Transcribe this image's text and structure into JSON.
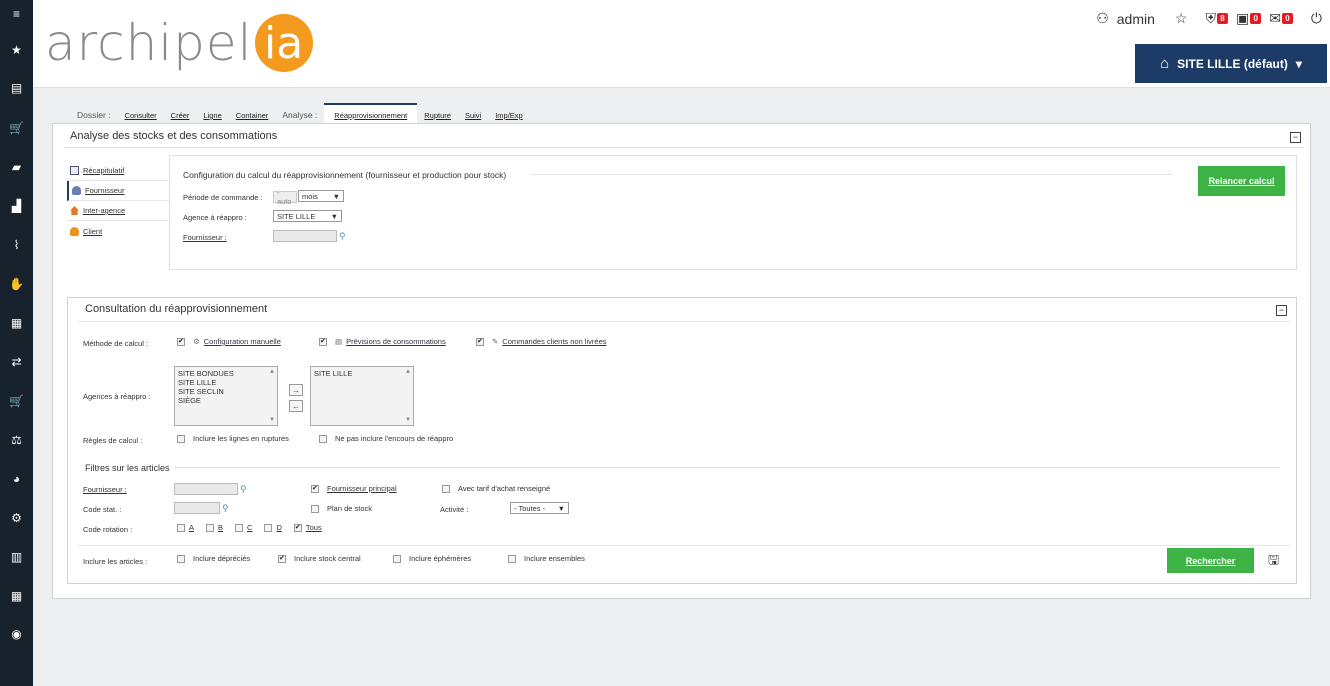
{
  "header": {
    "logo_text": "archipel",
    "logo_badge": "ia",
    "user": "admin",
    "badges": [
      "8",
      "0",
      "0"
    ],
    "site_button": "SITE LILLE (défaut)"
  },
  "tabs": {
    "dossier_label": "Dossier :",
    "consulter": "Consulter",
    "creer": "Créer",
    "ligne": "Ligne",
    "container": "Container",
    "analyse_label": "Analyse :",
    "reappro": "Réapprovisionnement",
    "rupture": "Rupture",
    "suivi": "Suivi",
    "impexp": "Imp/Exp"
  },
  "panel1": {
    "title": "Analyse des stocks et des consommations",
    "nav": [
      "Récapitulatif",
      "Fournisseur",
      "Inter-agence",
      "Client"
    ],
    "config_title": "Configuration du calcul du réapprovisionnement (fournisseur et production pour stock)",
    "periode_label": "Période de commande :",
    "periode_auto": "- auto",
    "periode_value": "mois",
    "agence_label": "Agence à réappro :",
    "agence_value": "SITE LILLE",
    "fournisseur_label": "Fournisseur :",
    "relancer": "Relancer calcul"
  },
  "panel2": {
    "title": "Consultation du réapprovisionnement",
    "methode_label": "Méthode de calcul :",
    "methodes": [
      "Configuration manuelle",
      "Prévisions de consommations",
      "Commandes clients non livrées"
    ],
    "agences_label": "Agences à réappro :",
    "agences_left": [
      "SITE BONDUES",
      "SITE LILLE",
      "SITE SECLIN",
      "SIÈGE"
    ],
    "agences_right": [
      "SITE LILLE"
    ],
    "regles_label": "Règles de calcul :",
    "regle1": "Inclure les lignes en ruptures",
    "regle2": "Ne pas inclure l'encours de réappro",
    "filtres_title": "Filtres sur les articles",
    "f_fournisseur": "Fournisseur :",
    "f_fourn_principal": "Fournisseur principal",
    "f_tarif": "Avec tarif d'achat renseigné",
    "f_codestat": "Code stat. :",
    "f_plan": "Plan de stock",
    "f_activite": "Activité :",
    "f_activite_value": "- Toutes -",
    "f_rotation": "Code rotation :",
    "rotations": [
      "A",
      "B",
      "C",
      "D",
      "Tous"
    ],
    "inclure_label": "Inclure les articles :",
    "inclure": [
      "Inclure dépréciés",
      "Inclure stock central",
      "Inclure éphémères",
      "Inclure ensembles"
    ],
    "rechercher": "Rechercher"
  }
}
